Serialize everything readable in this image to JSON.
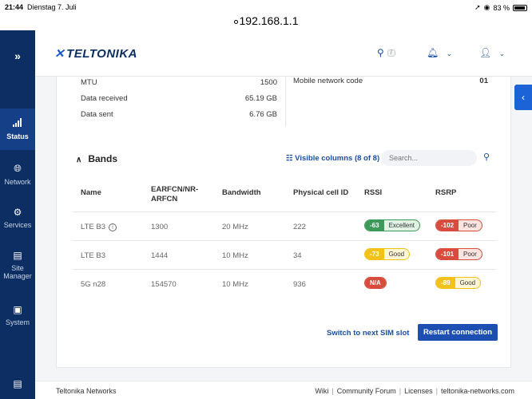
{
  "statusbar": {
    "time": "21:44",
    "date": "Dienstag 7. Juli",
    "battery": "83 %"
  },
  "browser": {
    "url": "192.168.1.1"
  },
  "sidebar": {
    "items": [
      {
        "label": "Status",
        "icon": "signal-icon"
      },
      {
        "label": "Network",
        "icon": "globe-icon"
      },
      {
        "label": "Services",
        "icon": "gear-icon"
      },
      {
        "label": "Site Manager",
        "icon": "site-manager-icon"
      },
      {
        "label": "System",
        "icon": "system-icon"
      }
    ],
    "active": "Status"
  },
  "header": {
    "brand": "TELTONIKA",
    "search_shortcut": "/"
  },
  "network_info": {
    "rows": [
      {
        "label": "MTU",
        "value": "1500"
      },
      {
        "label": "Data received",
        "value": "65.19 GB"
      },
      {
        "label": "Data sent",
        "value": "6.76 GB"
      }
    ],
    "right": {
      "label": "Mobile network code",
      "value": "01"
    }
  },
  "bands": {
    "title": "Bands",
    "visible_columns": "Visible columns (8 of 8)",
    "search_placeholder": "Search...",
    "columns": [
      "Name",
      "EARFCN/NR-ARFCN",
      "Bandwidth",
      "Physical cell ID",
      "RSSI",
      "RSRP"
    ],
    "rows": [
      {
        "name": "LTE B3",
        "earfcn": "1300",
        "bandwidth": "20 MHz",
        "pci": "222",
        "rssi": "-63",
        "rssi_text": "Excellent",
        "rsrp": "-102",
        "rsrp_text": "Poor"
      },
      {
        "name": "LTE B3",
        "earfcn": "1444",
        "bandwidth": "10 MHz",
        "pci": "34",
        "rssi": "-73",
        "rssi_text": "Good",
        "rsrp": "-101",
        "rsrp_text": "Poor"
      },
      {
        "name": "5G n28",
        "earfcn": "154570",
        "bandwidth": "10 MHz",
        "pci": "936",
        "rssi": "N/A",
        "rssi_text": "",
        "rsrp": "-89",
        "rsrp_text": "Good"
      }
    ]
  },
  "actions": {
    "switch_sim": "Switch to next SIM slot",
    "restart": "Restart connection"
  },
  "footer": {
    "company": "Teltonika Networks",
    "links": [
      "Wiki",
      "Community Forum",
      "Licenses",
      "teltonika-networks.com"
    ]
  },
  "colors": {
    "sidebar": "#0c2e63",
    "accent": "#1d4fb3",
    "good": "#3d9a5a",
    "poor": "#d84c3e",
    "fair": "#f2c21b"
  }
}
